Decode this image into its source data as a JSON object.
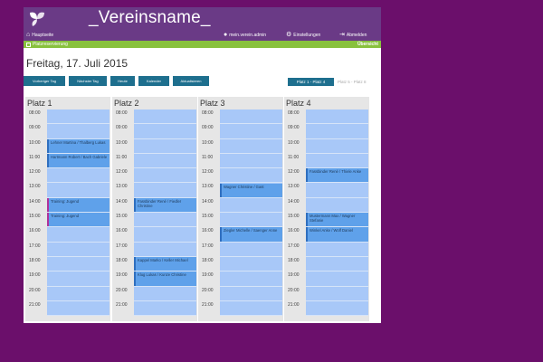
{
  "header": {
    "app_title": "_Vereinsname_",
    "nav": {
      "home": "Hauptseite",
      "user": "mein.verein.admin",
      "settings": "Einstellungen",
      "logout": "Abmelden"
    }
  },
  "subbar": {
    "section": "Platzreservierung",
    "overview": "Übersicht"
  },
  "page": {
    "date_title": "Freitag, 17. Juli 2015"
  },
  "toolbar": {
    "prev": "Vorheriger Tag",
    "next": "Nächster Tag",
    "today": "Heute",
    "calendar": "Kalender",
    "refresh": "Aktualisieren"
  },
  "court_tabs": {
    "active": "Platz 1 - Platz 4",
    "inactive": "Platz 5 - Platz 8"
  },
  "hours": [
    "08:00",
    "09:00",
    "10:00",
    "11:00",
    "12:00",
    "13:00",
    "14:00",
    "15:00",
    "16:00",
    "17:00",
    "18:00",
    "19:00",
    "20:00",
    "21:00"
  ],
  "columns": [
    {
      "title": "Platz 1",
      "bookings": [
        {
          "hour": "10:00",
          "text": "Lehner Martina / Thalberg Lukas",
          "type": "normal"
        },
        {
          "hour": "11:00",
          "text": "Hartmann Robert / Bach Gabriele",
          "type": "normal"
        },
        {
          "hour": "14:00",
          "text": "Training: Jugend",
          "type": "training"
        },
        {
          "hour": "15:00",
          "text": "Training: Jugend",
          "type": "training"
        }
      ]
    },
    {
      "title": "Platz 2",
      "bookings": [
        {
          "hour": "14:00",
          "text": "Fassbinder René / Fiedler Christine",
          "type": "normal"
        },
        {
          "hour": "18:00",
          "text": "Kappel Marko / Keller Michael",
          "type": "normal"
        },
        {
          "hour": "19:00",
          "text": "Klug Lukas / Kunze Christine",
          "type": "normal"
        }
      ]
    },
    {
      "title": "Platz 3",
      "bookings": [
        {
          "hour": "13:00",
          "text": "Wagner Christine / Gast",
          "type": "normal"
        },
        {
          "hour": "16:00",
          "text": "Ziegler Michelle / Saenger Anne",
          "type": "normal"
        }
      ]
    },
    {
      "title": "Platz 4",
      "bookings": [
        {
          "hour": "12:00",
          "text": "Fassbinder René / Thiele Anke",
          "type": "normal"
        },
        {
          "hour": "15:00",
          "text": "Mustermann Max / Wagner Stefanie",
          "type": "normal"
        },
        {
          "hour": "16:00",
          "text": "Winkel Anke / Wolf Daniel",
          "type": "normal"
        }
      ]
    }
  ],
  "colors": {
    "background": "#6b0f6b",
    "header": "#6a3a86",
    "subbar": "#88c13d",
    "button": "#1e6f8e",
    "slot": "#a8c8f8",
    "booking": "#5fa1ea",
    "training_marker": "#b0329b"
  }
}
